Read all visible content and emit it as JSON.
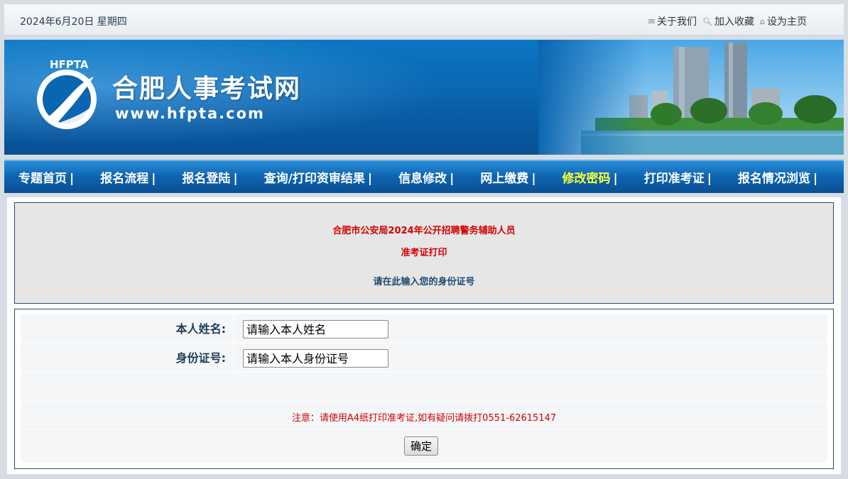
{
  "header": {
    "date": "2024年6月20日 星期四",
    "links": [
      {
        "label": "关于我们",
        "icon": "mail-icon"
      },
      {
        "label": "加入收藏",
        "icon": "search-icon"
      },
      {
        "label": "设为主页",
        "icon": "home-icon"
      }
    ]
  },
  "banner": {
    "logo_text": "HFPTA",
    "title": "合肥人事考试网",
    "url": "www.hfpta.com"
  },
  "nav": {
    "items": [
      {
        "label": "专题首页",
        "sep": "|"
      },
      {
        "label": "报名流程",
        "sep": "|"
      },
      {
        "label": "报名登陆",
        "sep": "|"
      },
      {
        "label": "查询/打印资审结果",
        "sep": "|"
      },
      {
        "label": "信息修改",
        "sep": "|"
      },
      {
        "label": "网上缴费",
        "sep": "|"
      },
      {
        "label": "修改密码",
        "sep": "|",
        "active": true
      },
      {
        "label": "打印准考证",
        "sep": "|"
      },
      {
        "label": "报名情况浏览",
        "sep": "|"
      }
    ]
  },
  "notice": {
    "exam_title": "合肥市公安局2024年公开招聘警务辅助人员",
    "subtitle": "准考证打印",
    "prompt": "请在此输入您的身份证号"
  },
  "form": {
    "name_label": "本人姓名:",
    "name_placeholder": "请输入本人姓名",
    "id_label": "身份证号:",
    "id_placeholder": "请输入本人身份证号",
    "note": "注意：请使用A4纸打印准考证,如有疑问请拨打0551-62615147",
    "submit_label": "确定"
  },
  "colors": {
    "nav_active": "#ffff33",
    "alert_red": "#d40000",
    "banner_blue": "#0b66b1"
  }
}
